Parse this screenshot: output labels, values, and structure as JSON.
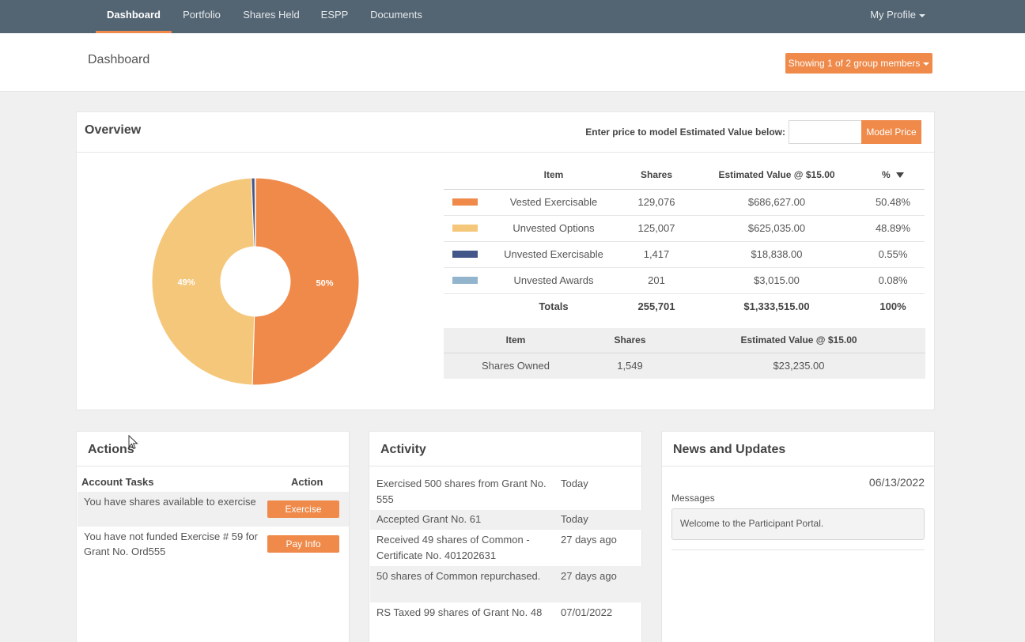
{
  "nav": {
    "items": [
      "Dashboard",
      "Portfolio",
      "Shares Held",
      "ESPP",
      "Documents"
    ],
    "active": "Dashboard",
    "profile_label": "My Profile"
  },
  "header": {
    "title": "Dashboard",
    "group_button": "Showing 1 of 2 group members"
  },
  "overview": {
    "title": "Overview",
    "model_label": "Enter price to model Estimated Value below:",
    "model_input_value": "",
    "model_button": "Model Price",
    "donut_labels": {
      "vested_exercisable": "50%",
      "unvested_options": "49%"
    },
    "table": {
      "headers": [
        "Item",
        "Shares",
        "Estimated Value @ $15.00",
        "%"
      ],
      "sort_indicator": "sort-desc-icon",
      "rows": [
        {
          "swatch": "#ef8a4a",
          "item": "Vested Exercisable",
          "shares": "129,076",
          "value": "$686,627.00",
          "pct": "50.48%"
        },
        {
          "swatch": "#f5c77a",
          "item": "Unvested Options",
          "shares": "125,007",
          "value": "$625,035.00",
          "pct": "48.89%"
        },
        {
          "swatch": "#44578a",
          "item": "Unvested Exercisable",
          "shares": "1,417",
          "value": "$18,838.00",
          "pct": "0.55%"
        },
        {
          "swatch": "#92b4cc",
          "item": "Unvested Awards",
          "shares": "201",
          "value": "$3,015.00",
          "pct": "0.08%"
        }
      ],
      "totals": {
        "label": "Totals",
        "shares": "255,701",
        "value": "$1,333,515.00",
        "pct": "100%"
      }
    },
    "owned_table": {
      "headers": [
        "Item",
        "Shares",
        "Estimated Value @ $15.00"
      ],
      "row": {
        "item": "Shares Owned",
        "shares": "1,549",
        "value": "$23,235.00"
      }
    }
  },
  "chart_data": {
    "type": "pie",
    "categories": [
      "Vested Exercisable",
      "Unvested Options",
      "Unvested Exercisable",
      "Unvested Awards"
    ],
    "values": [
      50.48,
      48.89,
      0.55,
      0.08
    ],
    "colors": [
      "#ef8a4a",
      "#f5c77a",
      "#44578a",
      "#92b4cc"
    ],
    "slice_labels": [
      "50%",
      "49%",
      "",
      ""
    ],
    "donut": true
  },
  "actions": {
    "title": "Actions",
    "col_tasks": "Account Tasks",
    "col_action": "Action",
    "rows": [
      {
        "text": "You have shares available to exercise",
        "button": "Exercise"
      },
      {
        "text": "You have not funded Exercise # 59 for Grant No. Ord555",
        "button": "Pay Info"
      }
    ]
  },
  "activity": {
    "title": "Activity",
    "rows": [
      {
        "text": "Exercised 500 shares from Grant No. 555",
        "when": "Today"
      },
      {
        "text": "Accepted Grant No. 61",
        "when": "Today"
      },
      {
        "text": "Received 49 shares of Common - Certificate No. 401202631",
        "when": "27 days ago"
      },
      {
        "text": "50 shares of Common repurchased.",
        "when": "27 days ago"
      },
      {
        "text": "RS Taxed 99 shares of Grant No. 48",
        "when": "07/01/2022"
      }
    ]
  },
  "news": {
    "title": "News and Updates",
    "date": "06/13/2022",
    "messages_label": "Messages",
    "message": "Welcome to the Participant Portal."
  },
  "colors": {
    "nav_bg": "#536472",
    "accent": "#ef8a4a",
    "page_bg": "#f0f0f0"
  }
}
